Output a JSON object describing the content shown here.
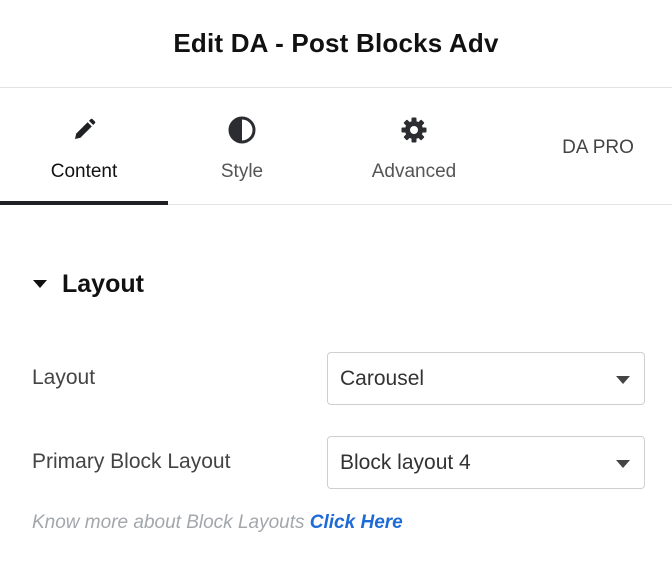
{
  "header": {
    "title": "Edit DA - Post Blocks Adv"
  },
  "tabs": [
    {
      "label": "Content",
      "icon": "pencil-icon",
      "active": true
    },
    {
      "label": "Style",
      "icon": "half-circle-icon",
      "active": false
    },
    {
      "label": "Advanced",
      "icon": "gear-icon",
      "active": false
    },
    {
      "label": "DA PRO",
      "icon": "",
      "active": false
    }
  ],
  "section": {
    "title": "Layout",
    "icon": "caret-down-icon",
    "expanded": true
  },
  "fields": {
    "layout": {
      "label": "Layout",
      "value": "Carousel"
    },
    "primary_block_layout": {
      "label": "Primary Block Layout",
      "value": "Block layout 4"
    }
  },
  "help": {
    "text": "Know more about Block Layouts",
    "link_text": "Click Here"
  },
  "colors": {
    "accent_link": "#1e6ad6",
    "active_tab_underline": "#1f2124",
    "border": "#e3e3e3"
  }
}
